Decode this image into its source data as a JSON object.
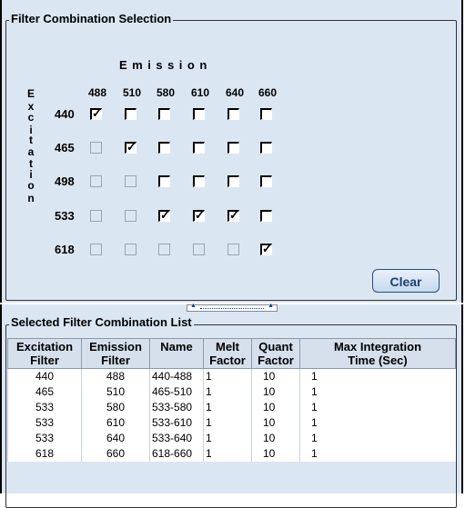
{
  "selection": {
    "title": "Filter Combination Selection",
    "emission_title": "Emission",
    "excitation_title": "Excitation",
    "emission_wavelengths": [
      "488",
      "510",
      "580",
      "610",
      "640",
      "660"
    ],
    "rows": [
      {
        "excitation": "440",
        "cells": [
          {
            "enabled": true,
            "checked": true
          },
          {
            "enabled": true,
            "checked": false
          },
          {
            "enabled": true,
            "checked": false
          },
          {
            "enabled": true,
            "checked": false
          },
          {
            "enabled": true,
            "checked": false
          },
          {
            "enabled": true,
            "checked": false
          }
        ]
      },
      {
        "excitation": "465",
        "cells": [
          {
            "enabled": false,
            "checked": false
          },
          {
            "enabled": true,
            "checked": true
          },
          {
            "enabled": true,
            "checked": false
          },
          {
            "enabled": true,
            "checked": false
          },
          {
            "enabled": true,
            "checked": false
          },
          {
            "enabled": true,
            "checked": false
          }
        ]
      },
      {
        "excitation": "498",
        "cells": [
          {
            "enabled": false,
            "checked": false
          },
          {
            "enabled": false,
            "checked": false
          },
          {
            "enabled": true,
            "checked": false
          },
          {
            "enabled": true,
            "checked": false
          },
          {
            "enabled": true,
            "checked": false
          },
          {
            "enabled": true,
            "checked": false
          }
        ]
      },
      {
        "excitation": "533",
        "cells": [
          {
            "enabled": false,
            "checked": false
          },
          {
            "enabled": false,
            "checked": false
          },
          {
            "enabled": true,
            "checked": true
          },
          {
            "enabled": true,
            "checked": true
          },
          {
            "enabled": true,
            "checked": true
          },
          {
            "enabled": true,
            "checked": false
          }
        ]
      },
      {
        "excitation": "618",
        "cells": [
          {
            "enabled": false,
            "checked": false
          },
          {
            "enabled": false,
            "checked": false
          },
          {
            "enabled": false,
            "checked": false
          },
          {
            "enabled": false,
            "checked": false
          },
          {
            "enabled": false,
            "checked": false
          },
          {
            "enabled": true,
            "checked": true
          }
        ]
      }
    ],
    "clear_label": "Clear"
  },
  "list": {
    "title": "Selected Filter Combination List",
    "columns": [
      [
        "Excitation",
        "Filter"
      ],
      [
        "Emission",
        "Filter"
      ],
      [
        "Name",
        ""
      ],
      [
        "Melt",
        "Factor"
      ],
      [
        "Quant",
        "Factor"
      ],
      [
        "Max Integration",
        "Time (Sec)"
      ]
    ],
    "rows": [
      [
        "440",
        "488",
        "440-488",
        "1",
        "10",
        "1"
      ],
      [
        "465",
        "510",
        "465-510",
        "1",
        "10",
        "1"
      ],
      [
        "533",
        "580",
        "533-580",
        "1",
        "10",
        "1"
      ],
      [
        "533",
        "610",
        "533-610",
        "1",
        "10",
        "1"
      ],
      [
        "533",
        "640",
        "533-640",
        "1",
        "10",
        "1"
      ],
      [
        "618",
        "660",
        "618-660",
        "1",
        "10",
        "1"
      ]
    ]
  },
  "colors": {
    "panel_bg": "#dbe6f3",
    "button_text": "#1f3f74"
  },
  "icons": {
    "splitter": "double-arrow-splitter-icon",
    "check": "checkmark-icon"
  }
}
